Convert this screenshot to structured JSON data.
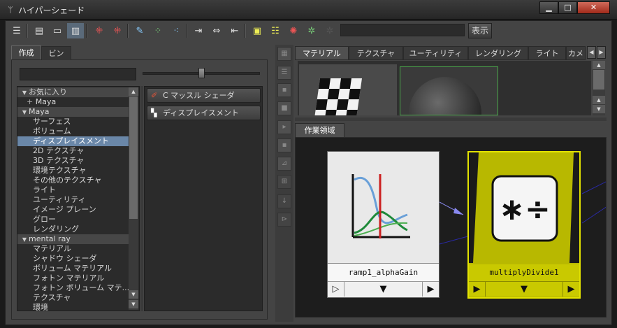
{
  "window": {
    "title": "ハイパーシェード",
    "min_label": "▁",
    "max_label": "□",
    "close_label": "✕"
  },
  "toolbar": {
    "show_label": "表示"
  },
  "left_panel": {
    "tabs": [
      {
        "label": "作成"
      },
      {
        "label": "ビン"
      }
    ],
    "tree": [
      {
        "label": "お気に入り",
        "type": "header"
      },
      {
        "label": "Maya",
        "type": "subitem"
      },
      {
        "label": "Maya",
        "type": "header"
      },
      {
        "label": "サーフェス",
        "type": "item"
      },
      {
        "label": "ボリューム",
        "type": "item"
      },
      {
        "label": "ディスプレイスメント",
        "type": "selected"
      },
      {
        "label": "2D テクスチャ",
        "type": "item"
      },
      {
        "label": "3D テクスチャ",
        "type": "item"
      },
      {
        "label": "環境テクスチャ",
        "type": "item"
      },
      {
        "label": "その他のテクスチャ",
        "type": "item"
      },
      {
        "label": "ライト",
        "type": "item"
      },
      {
        "label": "ユーティリティ",
        "type": "item"
      },
      {
        "label": "イメージ プレーン",
        "type": "item"
      },
      {
        "label": "グロー",
        "type": "item"
      },
      {
        "label": "レンダリング",
        "type": "item"
      },
      {
        "label": "mental ray",
        "type": "header"
      },
      {
        "label": "マテリアル",
        "type": "item"
      },
      {
        "label": "シャドウ シェーダ",
        "type": "item"
      },
      {
        "label": "ボリューム マテリアル",
        "type": "item"
      },
      {
        "label": "フォトン マテリアル",
        "type": "item"
      },
      {
        "label": "フォトン ボリューム マテ...",
        "type": "item"
      },
      {
        "label": "テクスチャ",
        "type": "item"
      },
      {
        "label": "環境",
        "type": "item"
      }
    ],
    "nodes": [
      {
        "label": "C マッスル シェーダ"
      },
      {
        "label": "ディスプレイスメント"
      }
    ]
  },
  "right_panel": {
    "tabs": [
      {
        "label": "マテリアル"
      },
      {
        "label": "テクスチャ"
      },
      {
        "label": "ユーティリティ"
      },
      {
        "label": "レンダリング"
      },
      {
        "label": "ライト"
      },
      {
        "label": "カメ"
      }
    ],
    "work_tab": "作業領域",
    "nodes": [
      {
        "name": "ramp1_alphaGain"
      },
      {
        "name": "multiplyDivide1",
        "symbol": "∗÷"
      }
    ]
  },
  "colors": {
    "selection": "#6a87a8",
    "node_yellow": "#b8b800",
    "node_border": "#e3e300",
    "swatch_border": "#4aa84a",
    "connection": "#2a2aa8"
  }
}
